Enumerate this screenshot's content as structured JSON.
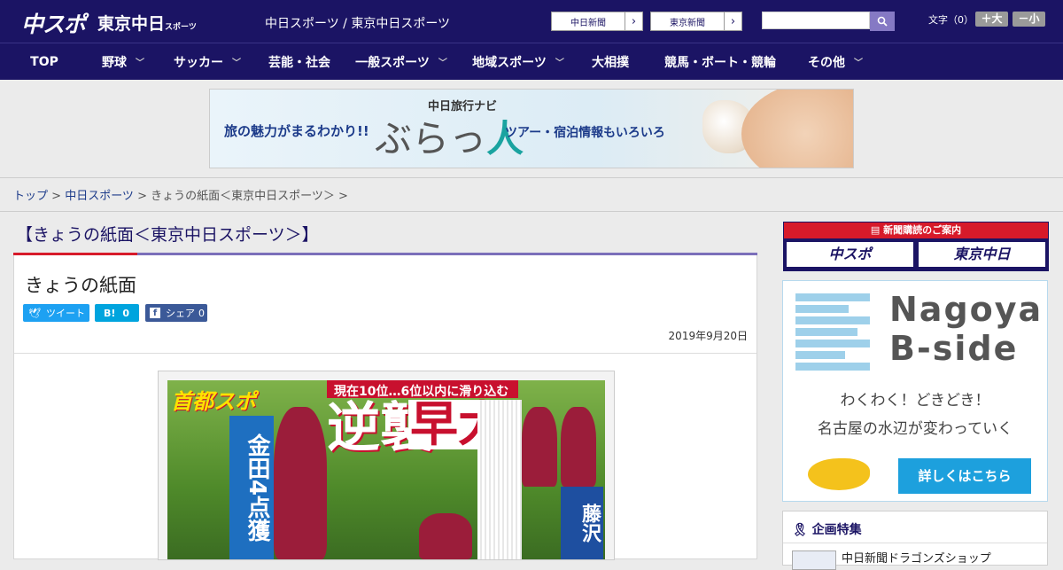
{
  "header": {
    "logo_chunichi": "中スポ",
    "logo_tokyo": "東京中日",
    "logo_tokyo_sub": "スポーツ",
    "site_name": "中日スポーツ / 東京中日スポーツ",
    "paper_buttons": [
      "中日新聞",
      "東京新聞"
    ],
    "search_placeholder": "",
    "font_size_label": "文字（0）",
    "font_larger": "＋大",
    "font_smaller": "－小"
  },
  "nav": {
    "items": [
      {
        "label": "TOP",
        "dropdown": false
      },
      {
        "label": "野球",
        "dropdown": true
      },
      {
        "label": "サッカー",
        "dropdown": true
      },
      {
        "label": "芸能・社会",
        "dropdown": false
      },
      {
        "label": "一般スポーツ",
        "dropdown": true
      },
      {
        "label": "地域スポーツ",
        "dropdown": true
      },
      {
        "label": "大相撲",
        "dropdown": false
      },
      {
        "label": "競馬・ボート・競輪",
        "dropdown": false
      },
      {
        "label": "その他",
        "dropdown": true
      }
    ]
  },
  "banner": {
    "left_text": "旅の魅力がまるわかり!!",
    "navi": "中日旅行ナビ",
    "big_a": "ぶらっ",
    "big_b": "人",
    "right_text": "ツアー・宿泊情報もいろいろ"
  },
  "breadcrumb": {
    "top": "トップ",
    "sep": " > ",
    "chunichi": "中日スポーツ",
    "current": "きょうの紙面＜東京中日スポーツ＞"
  },
  "section": {
    "title": "【きょうの紙面＜東京中日スポーツ＞】"
  },
  "article": {
    "title": "きょうの紙面",
    "share": {
      "tweet": "ツイート",
      "hatena": "B!",
      "hatena_count": "0",
      "fb": "シェア",
      "fb_count": "0"
    },
    "date": "2019年9月20日"
  },
  "paper": {
    "masthead": "首都スポ",
    "top_strip": "現在10位…6位以内に滑り込む",
    "headline_a": "逆襲",
    "headline_b": "早大",
    "side_blue": "金田4点獲",
    "side_right": "藤沢"
  },
  "sidebar": {
    "subscribe": {
      "header": "新聞購読のご案内",
      "btn1": "中スポ",
      "btn2": "東京中日"
    },
    "bside": {
      "title1": "Nagoya",
      "title2": "B-side",
      "line1": "わくわく！どきどき！",
      "line2": "名古屋の水辺が変わっていく",
      "cta": "詳しくはこちら"
    },
    "feature": {
      "header": "企画特集",
      "item": "中日新聞ドラゴンズショップ"
    }
  },
  "colors": {
    "navy": "#1b1464",
    "accent_red": "#d71a2a",
    "accent_purple": "#7b6fba",
    "cta_blue": "#1da0dd"
  }
}
